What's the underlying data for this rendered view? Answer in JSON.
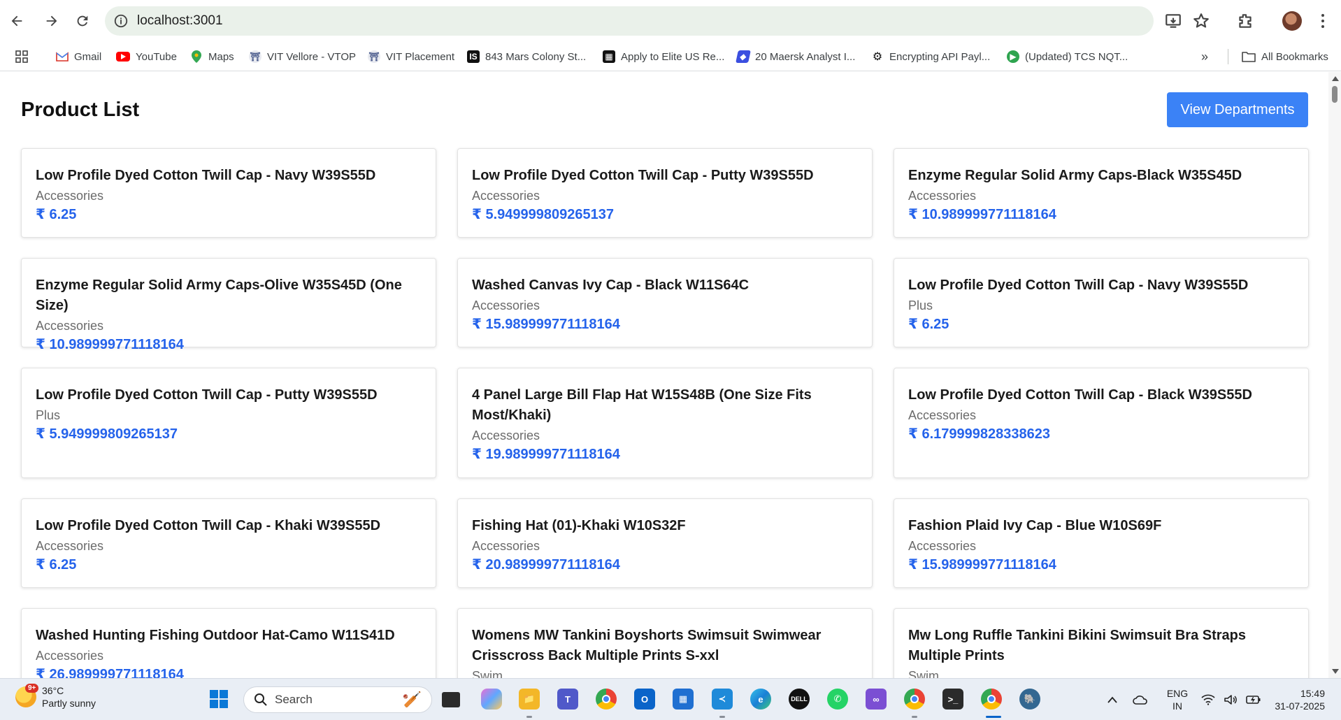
{
  "browser": {
    "url": "localhost:3001",
    "bookmarks": [
      {
        "label": "Gmail",
        "icon": "gmail-icon"
      },
      {
        "label": "YouTube",
        "icon": "youtube-icon"
      },
      {
        "label": "Maps",
        "icon": "maps-icon"
      },
      {
        "label": "VIT Vellore - VTOP",
        "icon": "vit-icon"
      },
      {
        "label": "VIT Placement",
        "icon": "vit-icon"
      },
      {
        "label": "843 Mars Colony St...",
        "icon": "site-icon"
      },
      {
        "label": "Apply to Elite US Re...",
        "icon": "site-icon"
      },
      {
        "label": "20 Maersk Analyst I...",
        "icon": "site-icon"
      },
      {
        "label": "Encrypting API Payl...",
        "icon": "openai-icon"
      },
      {
        "label": "(Updated) TCS NQT...",
        "icon": "site-icon"
      }
    ],
    "all_bookmarks_label": "All Bookmarks"
  },
  "page": {
    "title": "Product List",
    "view_departments_label": "View Departments",
    "currency": "₹",
    "products": [
      {
        "name": "Low Profile Dyed Cotton Twill Cap - Navy W39S55D",
        "category": "Accessories",
        "price": "₹ 6.25"
      },
      {
        "name": "Low Profile Dyed Cotton Twill Cap - Putty W39S55D",
        "category": "Accessories",
        "price": "₹ 5.949999809265137"
      },
      {
        "name": "Enzyme Regular Solid Army Caps-Black W35S45D",
        "category": "Accessories",
        "price": "₹ 10.989999771118164"
      },
      {
        "name": "Enzyme Regular Solid Army Caps-Olive W35S45D (One Size)",
        "category": "Accessories",
        "price": "₹ 10.989999771118164"
      },
      {
        "name": "Washed Canvas Ivy Cap - Black W11S64C",
        "category": "Accessories",
        "price": "₹ 15.989999771118164"
      },
      {
        "name": "Low Profile Dyed Cotton Twill Cap - Navy W39S55D",
        "category": "Plus",
        "price": "₹ 6.25"
      },
      {
        "name": "Low Profile Dyed Cotton Twill Cap - Putty W39S55D",
        "category": "Plus",
        "price": "₹ 5.949999809265137"
      },
      {
        "name": "4 Panel Large Bill Flap Hat W15S48B (One Size Fits Most/Khaki)",
        "category": "Accessories",
        "price": "₹ 19.989999771118164"
      },
      {
        "name": "Low Profile Dyed Cotton Twill Cap - Black W39S55D",
        "category": "Accessories",
        "price": "₹ 6.179999828338623"
      },
      {
        "name": "Low Profile Dyed Cotton Twill Cap - Khaki W39S55D",
        "category": "Accessories",
        "price": "₹ 6.25"
      },
      {
        "name": "Fishing Hat (01)-Khaki W10S32F",
        "category": "Accessories",
        "price": "₹ 20.989999771118164"
      },
      {
        "name": "Fashion Plaid Ivy Cap - Blue W10S69F",
        "category": "Accessories",
        "price": "₹ 15.989999771118164"
      },
      {
        "name": "Washed Hunting Fishing Outdoor Hat-Camo W11S41D",
        "category": "Accessories",
        "price": "₹ 26.989999771118164"
      },
      {
        "name": "Womens MW Tankini Boyshorts Swimsuit Swimwear Crisscross Back Multiple Prints S-xxl",
        "category": "Swim",
        "price": ""
      },
      {
        "name": "Mw Long Ruffle Tankini Bikini Swimsuit Bra Straps Multiple Prints",
        "category": "Swim",
        "price": ""
      }
    ]
  },
  "taskbar": {
    "weather_temp": "36°C",
    "weather_desc": "Partly sunny",
    "weather_badge": "9+",
    "search_placeholder": "Search",
    "lang_line1": "ENG",
    "lang_line2": "IN",
    "time": "15:49",
    "date": "31-07-2025"
  },
  "colors": {
    "accent_button": "#3b82f6",
    "price_text": "#2563eb",
    "category_text": "#6b6b6b"
  }
}
